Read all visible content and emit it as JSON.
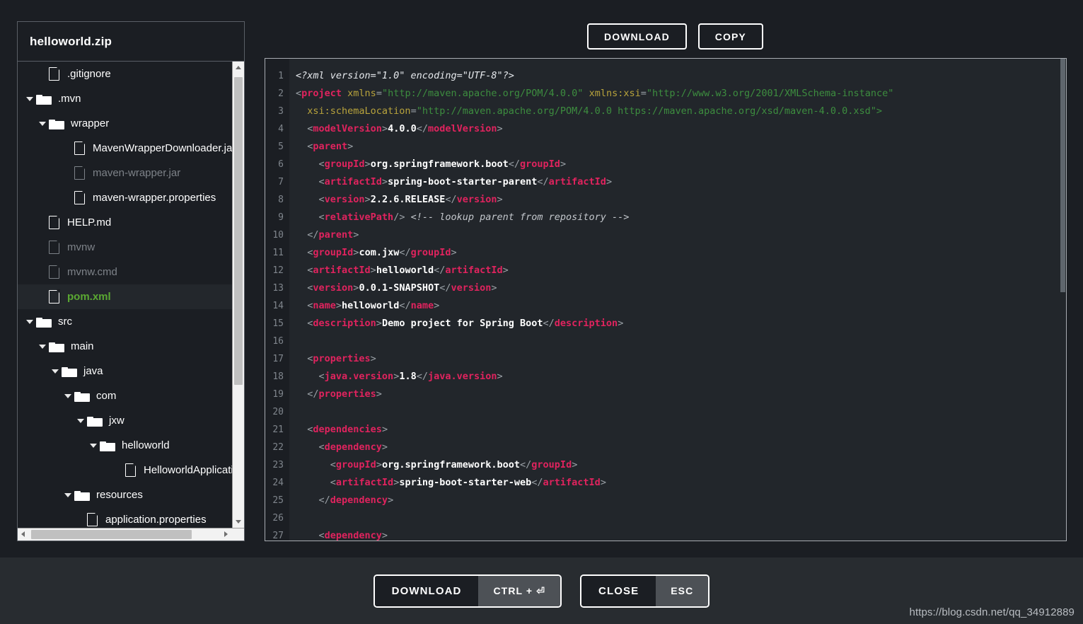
{
  "window": {
    "background": "#1b1e23",
    "footer_background": "#282c30"
  },
  "sidebar": {
    "zip_title": "helloworld.zip",
    "tree": [
      {
        "label": ".gitignore",
        "type": "file",
        "depth": 1,
        "state": "normal"
      },
      {
        "label": ".mvn",
        "type": "folder",
        "depth": 0,
        "state": "normal",
        "expanded": true
      },
      {
        "label": "wrapper",
        "type": "folder",
        "depth": 1,
        "state": "normal",
        "expanded": true
      },
      {
        "label": "MavenWrapperDownloader.java",
        "type": "file",
        "depth": 3,
        "state": "normal"
      },
      {
        "label": "maven-wrapper.jar",
        "type": "file",
        "depth": 3,
        "state": "dim"
      },
      {
        "label": "maven-wrapper.properties",
        "type": "file",
        "depth": 3,
        "state": "normal"
      },
      {
        "label": "HELP.md",
        "type": "file",
        "depth": 1,
        "state": "normal"
      },
      {
        "label": "mvnw",
        "type": "file",
        "depth": 1,
        "state": "dim"
      },
      {
        "label": "mvnw.cmd",
        "type": "file",
        "depth": 1,
        "state": "dim"
      },
      {
        "label": "pom.xml",
        "type": "file",
        "depth": 1,
        "state": "selected"
      },
      {
        "label": "src",
        "type": "folder",
        "depth": 0,
        "state": "normal",
        "expanded": true
      },
      {
        "label": "main",
        "type": "folder",
        "depth": 1,
        "state": "normal",
        "expanded": true
      },
      {
        "label": "java",
        "type": "folder",
        "depth": 2,
        "state": "normal",
        "expanded": true
      },
      {
        "label": "com",
        "type": "folder",
        "depth": 3,
        "state": "normal",
        "expanded": true
      },
      {
        "label": "jxw",
        "type": "folder",
        "depth": 4,
        "state": "normal",
        "expanded": true
      },
      {
        "label": "helloworld",
        "type": "folder",
        "depth": 5,
        "state": "normal",
        "expanded": true
      },
      {
        "label": "HelloworldApplication.java",
        "type": "file",
        "depth": 7,
        "state": "normal"
      },
      {
        "label": "resources",
        "type": "folder",
        "depth": 3,
        "state": "normal",
        "expanded": true
      },
      {
        "label": "application.properties",
        "type": "file",
        "depth": 4,
        "state": "normal"
      }
    ],
    "selected_color": "#5aa832"
  },
  "top_actions": {
    "download_label": "DOWNLOAD",
    "copy_label": "COPY"
  },
  "footer_actions": {
    "download_label": "DOWNLOAD",
    "download_shortcut": "CTRL + ⏎",
    "close_label": "CLOSE",
    "close_shortcut": "ESC"
  },
  "watermark": "https://blog.csdn.net/qq_34912889",
  "editor": {
    "first_visible_line": 1,
    "last_visible_line": 27,
    "lines": [
      {
        "n": 1,
        "tokens": [
          {
            "t": "dc",
            "s": "<?xml version=\"1.0\" encoding=\"UTF-8\"?>"
          }
        ]
      },
      {
        "n": 2,
        "tokens": [
          {
            "t": "br",
            "s": "<"
          },
          {
            "t": "tg",
            "s": "project"
          },
          {
            "t": "at",
            "s": " xmlns"
          },
          {
            "t": "br",
            "s": "="
          },
          {
            "t": "va",
            "s": "\"http://maven.apache.org/POM/4.0.0\""
          },
          {
            "t": "at",
            "s": " xmlns:xsi"
          },
          {
            "t": "br",
            "s": "="
          },
          {
            "t": "va",
            "s": "\"http://www.w3.org/2001/XMLSchema-instance\""
          }
        ]
      },
      {
        "n": 3,
        "tokens": [
          {
            "t": "at",
            "s": "  xsi:schemaLocation"
          },
          {
            "t": "br",
            "s": "="
          },
          {
            "t": "va",
            "s": "\"http://maven.apache.org/POM/4.0.0 https://maven.apache.org/xsd/maven-4.0.0.xsd\""
          },
          {
            "t": "va",
            "s": ">"
          }
        ]
      },
      {
        "n": 4,
        "tokens": [
          {
            "t": "br",
            "s": "  <"
          },
          {
            "t": "tg",
            "s": "modelVersion"
          },
          {
            "t": "br",
            "s": ">"
          },
          {
            "t": "tx",
            "s": "4.0.0"
          },
          {
            "t": "br",
            "s": "</"
          },
          {
            "t": "tg",
            "s": "modelVersion"
          },
          {
            "t": "br",
            "s": ">"
          }
        ]
      },
      {
        "n": 5,
        "tokens": [
          {
            "t": "br",
            "s": "  <"
          },
          {
            "t": "tg",
            "s": "parent"
          },
          {
            "t": "br",
            "s": ">"
          }
        ]
      },
      {
        "n": 6,
        "tokens": [
          {
            "t": "br",
            "s": "    <"
          },
          {
            "t": "tg",
            "s": "groupId"
          },
          {
            "t": "br",
            "s": ">"
          },
          {
            "t": "tx",
            "s": "org.springframework.boot"
          },
          {
            "t": "br",
            "s": "</"
          },
          {
            "t": "tg",
            "s": "groupId"
          },
          {
            "t": "br",
            "s": ">"
          }
        ]
      },
      {
        "n": 7,
        "tokens": [
          {
            "t": "br",
            "s": "    <"
          },
          {
            "t": "tg",
            "s": "artifactId"
          },
          {
            "t": "br",
            "s": ">"
          },
          {
            "t": "tx",
            "s": "spring-boot-starter-parent"
          },
          {
            "t": "br",
            "s": "</"
          },
          {
            "t": "tg",
            "s": "artifactId"
          },
          {
            "t": "br",
            "s": ">"
          }
        ]
      },
      {
        "n": 8,
        "tokens": [
          {
            "t": "br",
            "s": "    <"
          },
          {
            "t": "tg",
            "s": "version"
          },
          {
            "t": "br",
            "s": ">"
          },
          {
            "t": "tx",
            "s": "2.2.6.RELEASE"
          },
          {
            "t": "br",
            "s": "</"
          },
          {
            "t": "tg",
            "s": "version"
          },
          {
            "t": "br",
            "s": ">"
          }
        ]
      },
      {
        "n": 9,
        "tokens": [
          {
            "t": "br",
            "s": "    <"
          },
          {
            "t": "tg",
            "s": "relativePath"
          },
          {
            "t": "br",
            "s": "/> "
          },
          {
            "t": "cm",
            "s": "<!-- lookup parent from repository -->"
          }
        ]
      },
      {
        "n": 10,
        "tokens": [
          {
            "t": "br",
            "s": "  </"
          },
          {
            "t": "tg",
            "s": "parent"
          },
          {
            "t": "br",
            "s": ">"
          }
        ]
      },
      {
        "n": 11,
        "tokens": [
          {
            "t": "br",
            "s": "  <"
          },
          {
            "t": "tg",
            "s": "groupId"
          },
          {
            "t": "br",
            "s": ">"
          },
          {
            "t": "tx",
            "s": "com.jxw"
          },
          {
            "t": "br",
            "s": "</"
          },
          {
            "t": "tg",
            "s": "groupId"
          },
          {
            "t": "br",
            "s": ">"
          }
        ]
      },
      {
        "n": 12,
        "tokens": [
          {
            "t": "br",
            "s": "  <"
          },
          {
            "t": "tg",
            "s": "artifactId"
          },
          {
            "t": "br",
            "s": ">"
          },
          {
            "t": "tx",
            "s": "helloworld"
          },
          {
            "t": "br",
            "s": "</"
          },
          {
            "t": "tg",
            "s": "artifactId"
          },
          {
            "t": "br",
            "s": ">"
          }
        ]
      },
      {
        "n": 13,
        "tokens": [
          {
            "t": "br",
            "s": "  <"
          },
          {
            "t": "tg",
            "s": "version"
          },
          {
            "t": "br",
            "s": ">"
          },
          {
            "t": "tx",
            "s": "0.0.1-SNAPSHOT"
          },
          {
            "t": "br",
            "s": "</"
          },
          {
            "t": "tg",
            "s": "version"
          },
          {
            "t": "br",
            "s": ">"
          }
        ]
      },
      {
        "n": 14,
        "tokens": [
          {
            "t": "br",
            "s": "  <"
          },
          {
            "t": "tg",
            "s": "name"
          },
          {
            "t": "br",
            "s": ">"
          },
          {
            "t": "tx",
            "s": "helloworld"
          },
          {
            "t": "br",
            "s": "</"
          },
          {
            "t": "tg",
            "s": "name"
          },
          {
            "t": "br",
            "s": ">"
          }
        ]
      },
      {
        "n": 15,
        "tokens": [
          {
            "t": "br",
            "s": "  <"
          },
          {
            "t": "tg",
            "s": "description"
          },
          {
            "t": "br",
            "s": ">"
          },
          {
            "t": "tx",
            "s": "Demo project for Spring Boot"
          },
          {
            "t": "br",
            "s": "</"
          },
          {
            "t": "tg",
            "s": "description"
          },
          {
            "t": "br",
            "s": ">"
          }
        ]
      },
      {
        "n": 16,
        "tokens": [
          {
            "t": "br",
            "s": ""
          }
        ]
      },
      {
        "n": 17,
        "tokens": [
          {
            "t": "br",
            "s": "  <"
          },
          {
            "t": "tg",
            "s": "properties"
          },
          {
            "t": "br",
            "s": ">"
          }
        ]
      },
      {
        "n": 18,
        "tokens": [
          {
            "t": "br",
            "s": "    <"
          },
          {
            "t": "tg",
            "s": "java.version"
          },
          {
            "t": "br",
            "s": ">"
          },
          {
            "t": "tx",
            "s": "1.8"
          },
          {
            "t": "br",
            "s": "</"
          },
          {
            "t": "tg",
            "s": "java.version"
          },
          {
            "t": "br",
            "s": ">"
          }
        ]
      },
      {
        "n": 19,
        "tokens": [
          {
            "t": "br",
            "s": "  </"
          },
          {
            "t": "tg",
            "s": "properties"
          },
          {
            "t": "br",
            "s": ">"
          }
        ]
      },
      {
        "n": 20,
        "tokens": [
          {
            "t": "br",
            "s": ""
          }
        ]
      },
      {
        "n": 21,
        "tokens": [
          {
            "t": "br",
            "s": "  <"
          },
          {
            "t": "tg",
            "s": "dependencies"
          },
          {
            "t": "br",
            "s": ">"
          }
        ]
      },
      {
        "n": 22,
        "tokens": [
          {
            "t": "br",
            "s": "    <"
          },
          {
            "t": "tg",
            "s": "dependency"
          },
          {
            "t": "br",
            "s": ">"
          }
        ]
      },
      {
        "n": 23,
        "tokens": [
          {
            "t": "br",
            "s": "      <"
          },
          {
            "t": "tg",
            "s": "groupId"
          },
          {
            "t": "br",
            "s": ">"
          },
          {
            "t": "tx",
            "s": "org.springframework.boot"
          },
          {
            "t": "br",
            "s": "</"
          },
          {
            "t": "tg",
            "s": "groupId"
          },
          {
            "t": "br",
            "s": ">"
          }
        ]
      },
      {
        "n": 24,
        "tokens": [
          {
            "t": "br",
            "s": "      <"
          },
          {
            "t": "tg",
            "s": "artifactId"
          },
          {
            "t": "br",
            "s": ">"
          },
          {
            "t": "tx",
            "s": "spring-boot-starter-web"
          },
          {
            "t": "br",
            "s": "</"
          },
          {
            "t": "tg",
            "s": "artifactId"
          },
          {
            "t": "br",
            "s": ">"
          }
        ]
      },
      {
        "n": 25,
        "tokens": [
          {
            "t": "br",
            "s": "    </"
          },
          {
            "t": "tg",
            "s": "dependency"
          },
          {
            "t": "br",
            "s": ">"
          }
        ]
      },
      {
        "n": 26,
        "tokens": [
          {
            "t": "br",
            "s": ""
          }
        ]
      },
      {
        "n": 27,
        "tokens": [
          {
            "t": "br",
            "s": "    <"
          },
          {
            "t": "tg",
            "s": "dependency"
          },
          {
            "t": "br",
            "s": ">"
          }
        ]
      }
    ]
  }
}
